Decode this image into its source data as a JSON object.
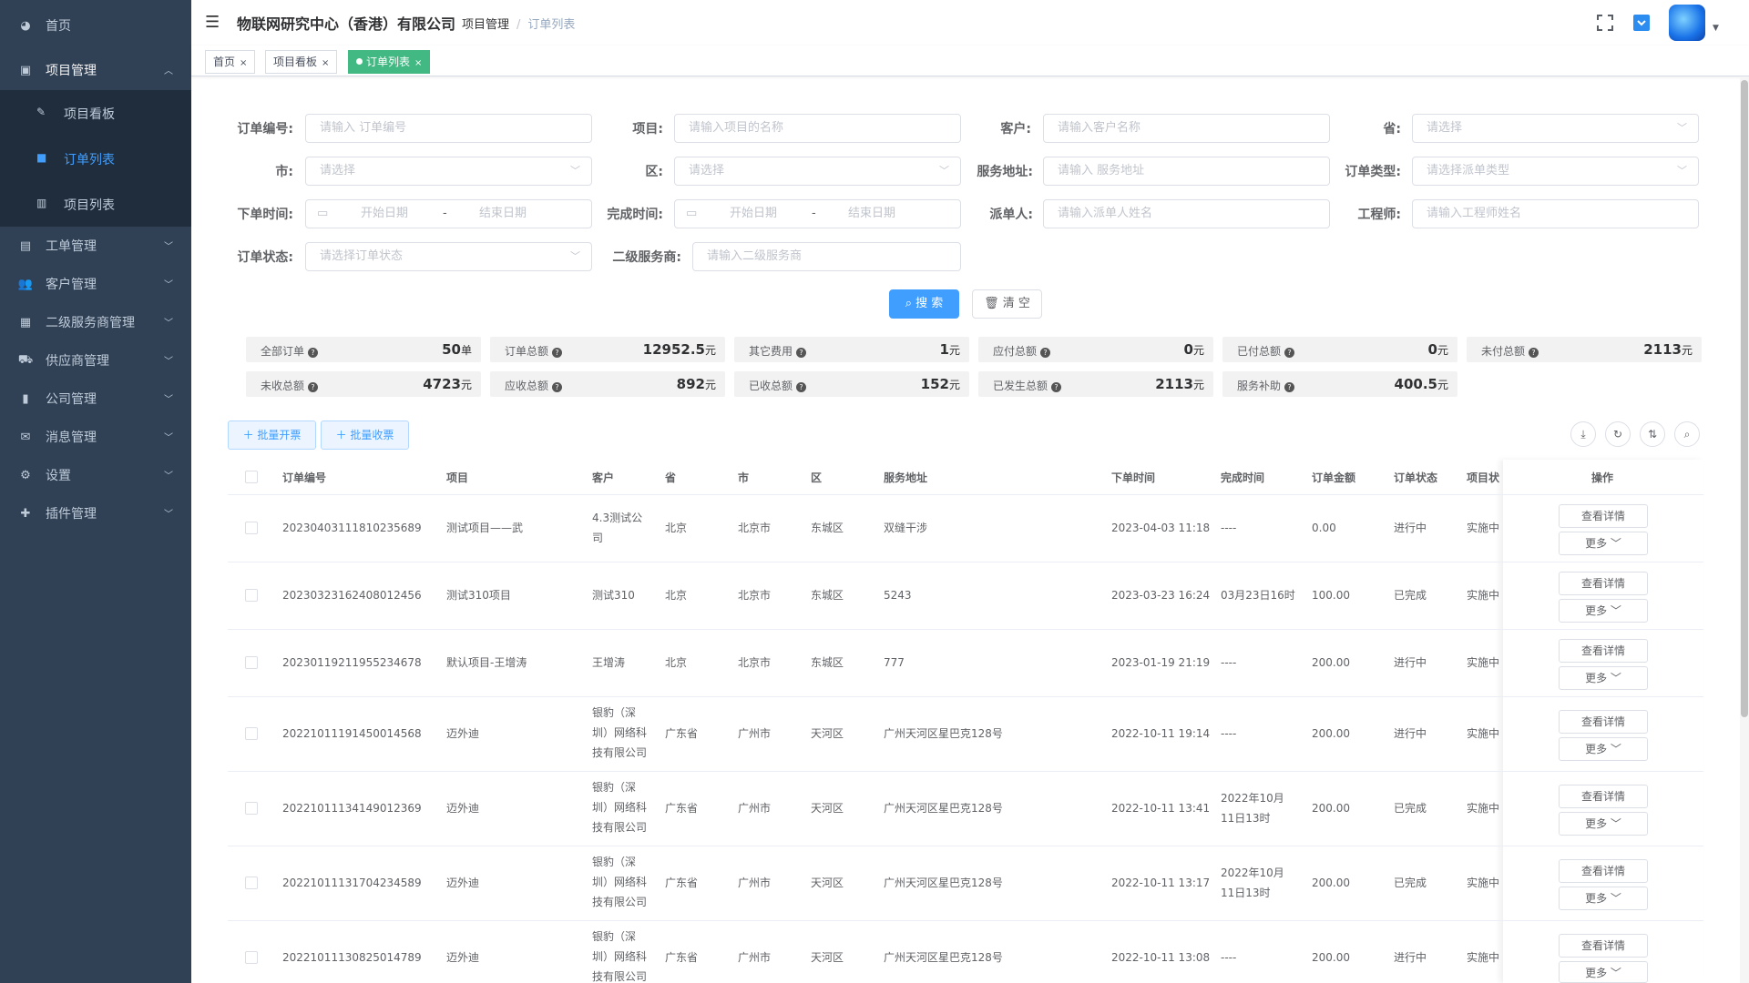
{
  "sidebar": {
    "items": [
      {
        "label": "首页",
        "icon": "dashboard-icon"
      },
      {
        "label": "项目管理",
        "icon": "project-icon"
      },
      {
        "label": "工单管理",
        "icon": "clipboard-icon"
      },
      {
        "label": "客户管理",
        "icon": "users-icon"
      },
      {
        "label": "二级服务商管理",
        "icon": "document-icon"
      },
      {
        "label": "供应商管理",
        "icon": "supplier-icon"
      },
      {
        "label": "公司管理",
        "icon": "chart-icon"
      },
      {
        "label": "消息管理",
        "icon": "message-icon"
      },
      {
        "label": "设置",
        "icon": "gear-icon"
      },
      {
        "label": "插件管理",
        "icon": "plugin-icon"
      }
    ],
    "sub_items": [
      {
        "label": "项目看板"
      },
      {
        "label": "订单列表"
      },
      {
        "label": "项目列表"
      }
    ]
  },
  "header": {
    "company": "物联网研究中心（香港）有限公司",
    "breadcrumb": [
      "项目管理",
      "订单列表"
    ]
  },
  "tags": [
    {
      "label": "首页"
    },
    {
      "label": "项目看板"
    },
    {
      "label": "订单列表"
    }
  ],
  "filters": {
    "order_no": {
      "label": "订单编号:",
      "placeholder": "请输入 订单编号"
    },
    "project": {
      "label": "项目:",
      "placeholder": "请输入项目的名称"
    },
    "customer": {
      "label": "客户:",
      "placeholder": "请输入客户名称"
    },
    "province": {
      "label": "省:",
      "placeholder": "请选择"
    },
    "city": {
      "label": "市:",
      "placeholder": "请选择"
    },
    "district": {
      "label": "区:",
      "placeholder": "请选择"
    },
    "address": {
      "label": "服务地址:",
      "placeholder": "请输入 服务地址"
    },
    "order_type": {
      "label": "订单类型:",
      "placeholder": "请选择派单类型"
    },
    "order_time": {
      "label": "下单时间:",
      "start": "开始日期",
      "sep": "-",
      "end": "结束日期"
    },
    "finish_time": {
      "label": "完成时间:",
      "start": "开始日期",
      "sep": "-",
      "end": "结束日期"
    },
    "dispatcher": {
      "label": "派单人:",
      "placeholder": "请输入派单人姓名"
    },
    "engineer": {
      "label": "工程师:",
      "placeholder": "请输入工程师姓名"
    },
    "status": {
      "label": "订单状态:",
      "placeholder": "请选择订单状态"
    },
    "sub_provider": {
      "label": "二级服务商:",
      "placeholder": "请输入二级服务商"
    },
    "search_label": "搜 索",
    "clear_label": "清 空"
  },
  "stats": [
    {
      "label": "全部订单",
      "value": "50",
      "unit": "单"
    },
    {
      "label": "订单总额",
      "value": "12952.5",
      "unit": "元"
    },
    {
      "label": "其它费用",
      "value": "1",
      "unit": "元"
    },
    {
      "label": "应付总额",
      "value": "0",
      "unit": "元"
    },
    {
      "label": "已付总额",
      "value": "0",
      "unit": "元"
    },
    {
      "label": "未付总额",
      "value": "2113",
      "unit": "元"
    },
    {
      "label": "未收总额",
      "value": "4723",
      "unit": "元"
    },
    {
      "label": "应收总额",
      "value": "892",
      "unit": "元"
    },
    {
      "label": "已收总额",
      "value": "152",
      "unit": "元"
    },
    {
      "label": "已发生总额",
      "value": "2113",
      "unit": "元"
    },
    {
      "label": "服务补助",
      "value": "400.5",
      "unit": "元"
    }
  ],
  "toolbar": {
    "batch_invoice": "批量开票",
    "batch_receipt": "批量收票"
  },
  "table": {
    "headers": [
      "订单编号",
      "项目",
      "客户",
      "省",
      "市",
      "区",
      "服务地址",
      "下单时间",
      "完成时间",
      "订单金额",
      "订单状态",
      "项目状",
      "操作"
    ],
    "rows": [
      {
        "no": "20230403111810235689",
        "project": "测试项目——武",
        "customer": "4.3测试公司",
        "province": "北京",
        "city": "北京市",
        "district": "东城区",
        "address": "双缝干涉",
        "order_time": "2023-04-03 11:18",
        "finish_time": "----",
        "amount": "0.00",
        "status": "进行中",
        "pstatus": "实施中"
      },
      {
        "no": "20230323162408012456",
        "project": "测试310项目",
        "customer": "测试310",
        "province": "北京",
        "city": "北京市",
        "district": "东城区",
        "address": "5243",
        "order_time": "2023-03-23 16:24",
        "finish_time": "03月23日16时",
        "amount": "100.00",
        "status": "已完成",
        "pstatus": "实施中"
      },
      {
        "no": "20230119211955234678",
        "project": "默认项目-王增涛",
        "customer": "王增涛",
        "province": "北京",
        "city": "北京市",
        "district": "东城区",
        "address": "777",
        "order_time": "2023-01-19 21:19",
        "finish_time": "----",
        "amount": "200.00",
        "status": "进行中",
        "pstatus": "实施中"
      },
      {
        "no": "20221011191450014568",
        "project": "迈外迪",
        "customer": "银豹（深圳）网络科技有限公司",
        "province": "广东省",
        "city": "广州市",
        "district": "天河区",
        "address": "广州天河区星巴克128号",
        "order_time": "2022-10-11 19:14",
        "finish_time": "----",
        "amount": "200.00",
        "status": "进行中",
        "pstatus": "实施中"
      },
      {
        "no": "20221011134149012369",
        "project": "迈外迪",
        "customer": "银豹（深圳）网络科技有限公司",
        "province": "广东省",
        "city": "广州市",
        "district": "天河区",
        "address": "广州天河区星巴克128号",
        "order_time": "2022-10-11 13:41",
        "finish_time": "2022年10月11日13时",
        "amount": "200.00",
        "status": "已完成",
        "pstatus": "实施中"
      },
      {
        "no": "20221011131704234589",
        "project": "迈外迪",
        "customer": "银豹（深圳）网络科技有限公司",
        "province": "广东省",
        "city": "广州市",
        "district": "天河区",
        "address": "广州天河区星巴克128号",
        "order_time": "2022-10-11 13:17",
        "finish_time": "2022年10月11日13时",
        "amount": "200.00",
        "status": "已完成",
        "pstatus": "实施中"
      },
      {
        "no": "20221011130825014789",
        "project": "迈外迪",
        "customer": "银豹（深圳）网络科技有限公司",
        "province": "广东省",
        "city": "广州市",
        "district": "天河区",
        "address": "广州天河区星巴克128号",
        "order_time": "2022-10-11 13:08",
        "finish_time": "----",
        "amount": "200.00",
        "status": "进行中",
        "pstatus": "实施中"
      }
    ],
    "detail_label": "查看详情",
    "more_label": "更多"
  }
}
